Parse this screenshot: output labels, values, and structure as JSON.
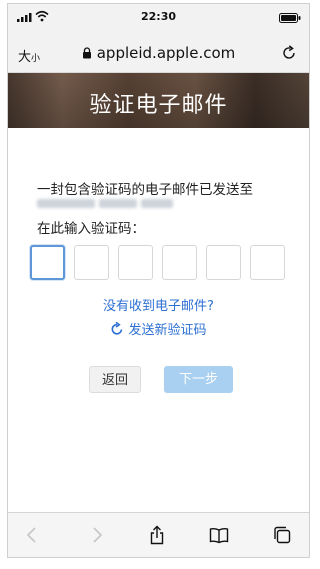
{
  "status_bar": {
    "time": "22:30"
  },
  "address_bar": {
    "text_size_label_large": "大",
    "text_size_label_small": "小",
    "url": "appleid.apple.com"
  },
  "page": {
    "title": "验证电子邮件",
    "sent_message": "一封包含验证码的电子邮件已发送至",
    "code_prompt": "在此输入验证码：",
    "code_digits": [
      "",
      "",
      "",
      "",
      "",
      ""
    ],
    "no_email_link": "没有收到电子邮件?",
    "resend_link": "发送新验证码",
    "back_button": "返回",
    "next_button": "下一步"
  },
  "colors": {
    "link": "#2c6fd3",
    "active_box_border": "#5d97d8",
    "next_button_disabled": "#a9d0f0",
    "banner_dark": "#4a3a30"
  },
  "toolbar": {
    "icons": [
      "back-icon",
      "forward-icon",
      "share-icon",
      "bookmarks-icon",
      "tabs-icon"
    ]
  }
}
